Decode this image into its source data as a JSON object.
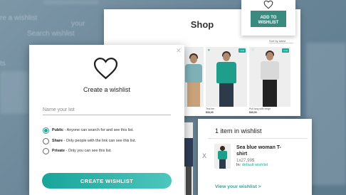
{
  "background": {
    "texts": [
      "re a wishlist",
      "Search wishlist",
      "your",
      "ts"
    ]
  },
  "shop": {
    "title": "Shop",
    "sort_label": "Sort by latest",
    "products": [
      {
        "name": "",
        "price": ""
      },
      {
        "name": "Teal tee",
        "price": "$33,00"
      },
      {
        "name": "",
        "price": ""
      },
      {
        "name": "Pull long with beige",
        "price": "$33,00"
      }
    ]
  },
  "callout": {
    "button_label": "ADD TO WISHLIST"
  },
  "modal": {
    "title": "Create a wishlist",
    "name_placeholder": "Name your list",
    "name_value": "",
    "options": [
      {
        "bold": "Public",
        "text": " - Anyone can search for and see this list.",
        "checked": true
      },
      {
        "bold": "Share",
        "text": " - Only people with the link can see this list.",
        "checked": false
      },
      {
        "bold": "Private",
        "text": " - Only you can see this list.",
        "checked": false
      }
    ],
    "create_label": "CREATE  WISHLIST"
  },
  "summary": {
    "title": "1 item in wishlist",
    "item_name": "Sea blue woman T-shirt",
    "item_price": "1x27,99$",
    "item_in_label": "In:",
    "item_in_list": "default wishlist",
    "view_link": "View your wishlist >"
  },
  "colors": {
    "accent": "#26a69a",
    "callout_button": "#3a8a80"
  }
}
